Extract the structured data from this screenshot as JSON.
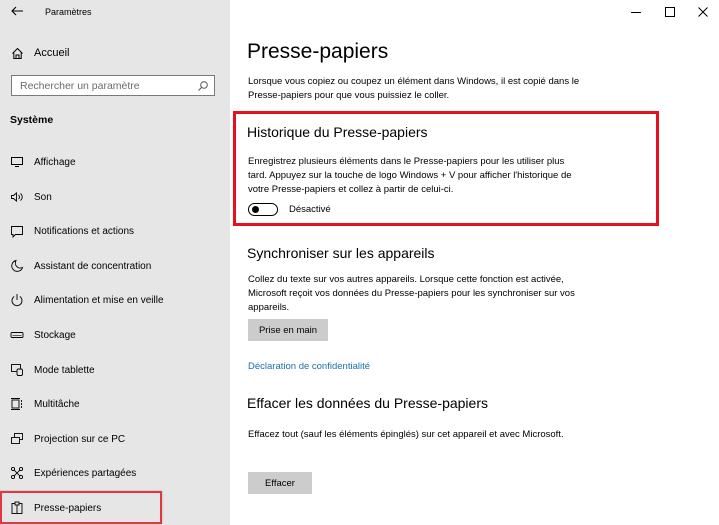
{
  "window": {
    "title": "Paramètres",
    "controls": {
      "minimize": "minimize-icon",
      "maximize": "maximize-icon",
      "close": "close-icon"
    }
  },
  "sidebar": {
    "back_icon": "back-arrow-icon",
    "home": {
      "label": "Accueil",
      "icon": "home-icon"
    },
    "search": {
      "placeholder": "Rechercher un paramètre",
      "value": "",
      "icon": "search-icon"
    },
    "section": "Système",
    "items": [
      {
        "label": "Affichage",
        "icon": "display-icon"
      },
      {
        "label": "Son",
        "icon": "sound-icon"
      },
      {
        "label": "Notifications et actions",
        "icon": "notifications-icon"
      },
      {
        "label": "Assistant de concentration",
        "icon": "moon-icon"
      },
      {
        "label": "Alimentation et mise en veille",
        "icon": "power-icon"
      },
      {
        "label": "Stockage",
        "icon": "storage-icon"
      },
      {
        "label": "Mode tablette",
        "icon": "tablet-mode-icon"
      },
      {
        "label": "Multitâche",
        "icon": "multitasking-icon"
      },
      {
        "label": "Projection sur ce PC",
        "icon": "projection-icon"
      },
      {
        "label": "Expériences partagées",
        "icon": "shared-experiences-icon"
      },
      {
        "label": "Presse-papiers",
        "icon": "clipboard-icon",
        "selected": true
      }
    ]
  },
  "main": {
    "title": "Presse-papiers",
    "intro": "Lorsque vous copiez ou coupez un élément dans Windows, il est copié dans le Presse-papiers pour que vous puissiez le coller.",
    "history": {
      "heading": "Historique du Presse-papiers",
      "description": "Enregistrez plusieurs éléments dans le Presse-papiers pour les utiliser plus tard. Appuyez sur la touche de logo Windows + V pour afficher l'historique de votre Presse-papiers et collez à partir de celui-ci.",
      "toggle_state": "off",
      "toggle_label": "Désactivé"
    },
    "sync": {
      "heading": "Synchroniser sur les appareils",
      "description": "Collez du texte sur vos autres appareils. Lorsque cette fonction est activée, Microsoft reçoit vos données du Presse-papiers pour les synchroniser sur vos appareils.",
      "button": "Prise en main"
    },
    "privacy_link": "Déclaration de confidentialité",
    "clear": {
      "heading": "Effacer les données du Presse-papiers",
      "description": "Effacez tout (sauf les éléments épinglés) sur cet appareil et avec Microsoft.",
      "button": "Effacer"
    }
  },
  "colors": {
    "sidebar_bg": "#e6e6e6",
    "highlight_red": "#e3101f",
    "link_blue": "#1b6fa8",
    "button_bg": "#cccccc"
  }
}
